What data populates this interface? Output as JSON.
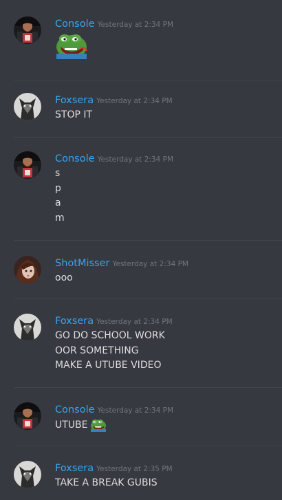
{
  "messages": [
    {
      "author": "Console",
      "timestamp": "Yesterday at 2:34 PM",
      "lines": [],
      "emoji": "pepe-rage-emoji"
    },
    {
      "author": "Foxsera",
      "timestamp": "Yesterday at 2:34 PM",
      "lines": [
        "STOP IT"
      ]
    },
    {
      "author": "Console",
      "timestamp": "Yesterday at 2:34 PM",
      "lines": [
        "s",
        "p",
        "a",
        "m"
      ]
    },
    {
      "author": "ShotMisser",
      "timestamp": "Yesterday at 2:34 PM",
      "lines": [
        "ooo"
      ]
    },
    {
      "author": "Foxsera",
      "timestamp": "Yesterday at 2:34 PM",
      "lines": [
        "GO DO SCHOOL WORK",
        "OOR SOMETHING",
        "MAKE A UTUBE VIDEO"
      ]
    },
    {
      "author": "Console",
      "timestamp": "Yesterday at 2:34 PM",
      "lines": [
        "UTUBE"
      ],
      "inline_emoji": "pepe-rage-emoji"
    },
    {
      "author": "Foxsera",
      "timestamp": "Yesterday at 2:35 PM",
      "lines": [
        "TAKE A BREAK GUBIS"
      ]
    }
  ],
  "colors": {
    "background": "#36393f",
    "username": "#3ba5ee",
    "timestamp": "#72767d",
    "text": "#dcddde",
    "divider": "#42454a"
  }
}
